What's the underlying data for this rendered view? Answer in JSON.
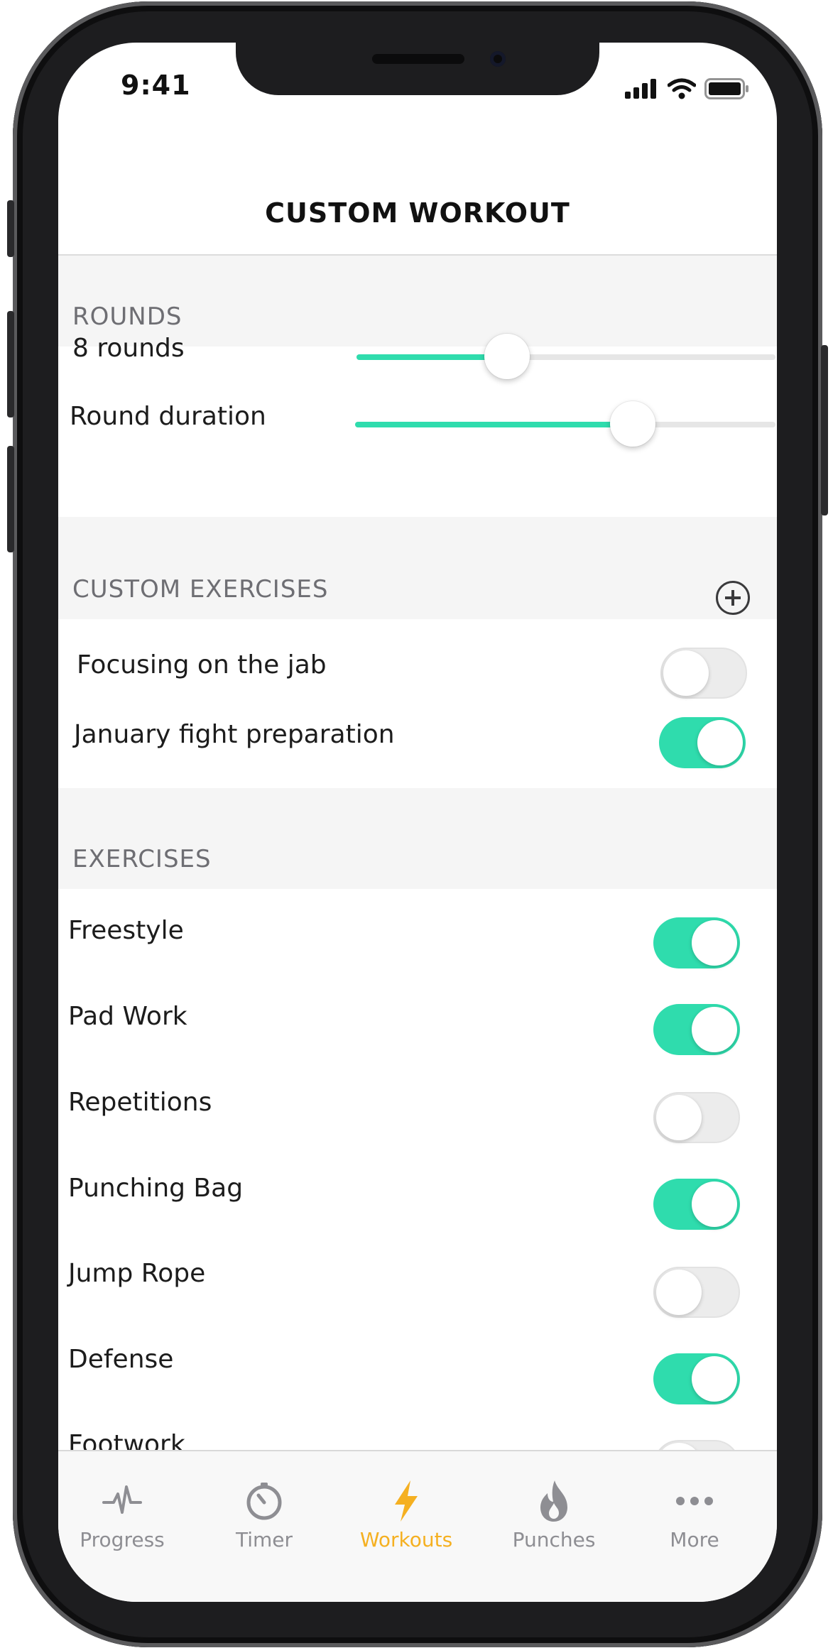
{
  "status_bar": {
    "time": "9:41"
  },
  "header": {
    "title": "CUSTOM WORKOUT"
  },
  "rounds_section": {
    "header": "ROUNDS",
    "rounds_label": "8 rounds",
    "rounds_slider_fraction": 0.36,
    "duration_label": "Round duration",
    "duration_slider_fraction": 0.66
  },
  "custom_exercises_section": {
    "header": "CUSTOM EXERCISES",
    "items": [
      {
        "label": "Focusing on the jab",
        "enabled": false
      },
      {
        "label": "January fight preparation",
        "enabled": true
      }
    ]
  },
  "exercises_section": {
    "header": "EXERCISES",
    "items": [
      {
        "label": "Freestyle",
        "enabled": true
      },
      {
        "label": "Pad Work",
        "enabled": true
      },
      {
        "label": "Repetitions",
        "enabled": false
      },
      {
        "label": "Punching Bag",
        "enabled": true
      },
      {
        "label": "Jump Rope",
        "enabled": false
      },
      {
        "label": "Defense",
        "enabled": true
      },
      {
        "label": "Footwork",
        "enabled": false
      }
    ]
  },
  "tab_bar": {
    "tabs": [
      {
        "label": "Progress",
        "icon": "pulse-icon",
        "active": false
      },
      {
        "label": "Timer",
        "icon": "timer-icon",
        "active": false
      },
      {
        "label": "Workouts",
        "icon": "lightning-icon",
        "active": true
      },
      {
        "label": "Punches",
        "icon": "flame-icon",
        "active": false
      },
      {
        "label": "More",
        "icon": "ellipsis-icon",
        "active": false
      }
    ]
  },
  "colors": {
    "accent": "#2fdcad",
    "active_tab": "#f5b021",
    "inactive_tab": "#8e8e93",
    "section_background": "#f5f5f5"
  }
}
